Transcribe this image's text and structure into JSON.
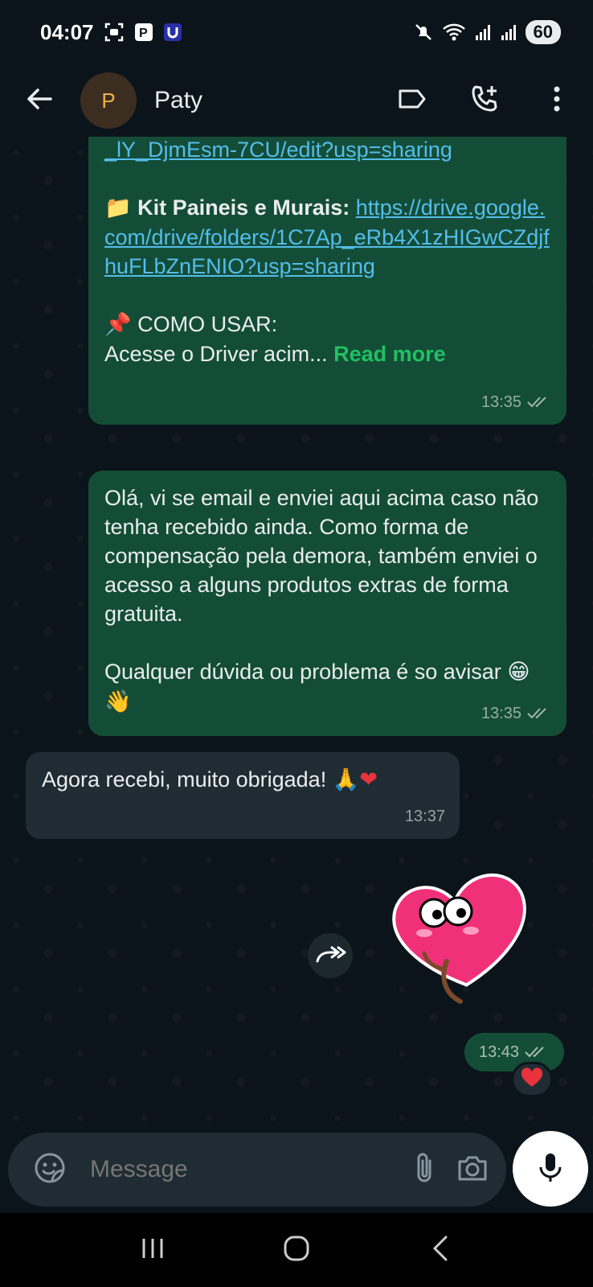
{
  "status_bar": {
    "time": "04:07",
    "battery": "60"
  },
  "header": {
    "avatar_letter": "P",
    "contact_name": "Paty"
  },
  "messages": [
    {
      "id": "b1",
      "link_top": "_lY_DjmEsm-7CU/edit?usp=sharing",
      "kit_label": "Kit Paineis e Murais:",
      "kit_link": "https://drive.google.com/drive/folders/1C7Ap_eRb4X1zHIGwCZdjfhuFLbZnENIO?usp=sharing",
      "como_usar": "COMO USAR:",
      "preview": "Acesse o Driver acim...",
      "read_more": "Read more",
      "time": "13:35"
    },
    {
      "id": "b2",
      "text1": "Olá, vi se email e enviei aqui acima caso não tenha recebido ainda. Como forma de compensação pela demora, também enviei o acesso a alguns produtos extras de forma gratuita.",
      "text2": "Qualquer dúvida ou problema é so avisar",
      "time": "13:35"
    },
    {
      "id": "b3",
      "text": "Agora recebi, muito obrigada!",
      "time": "13:37"
    },
    {
      "id": "sticker",
      "time": "13:43",
      "reaction": "heart"
    }
  ],
  "composer": {
    "placeholder": "Message"
  },
  "icons": {
    "back": "arrow-left-icon",
    "label": "label-tag-icon",
    "add_call": "add-call-icon",
    "menu": "more-vertical-icon",
    "sticker": "sticker-icon",
    "attach": "paperclip-icon",
    "camera": "camera-icon",
    "mic": "microphone-icon",
    "forward": "forward-icon"
  },
  "colors": {
    "outgoing": "#144d37",
    "incoming": "#202c33",
    "link": "#53bdeb",
    "read_more": "#21c063",
    "background": "#0b141a"
  }
}
